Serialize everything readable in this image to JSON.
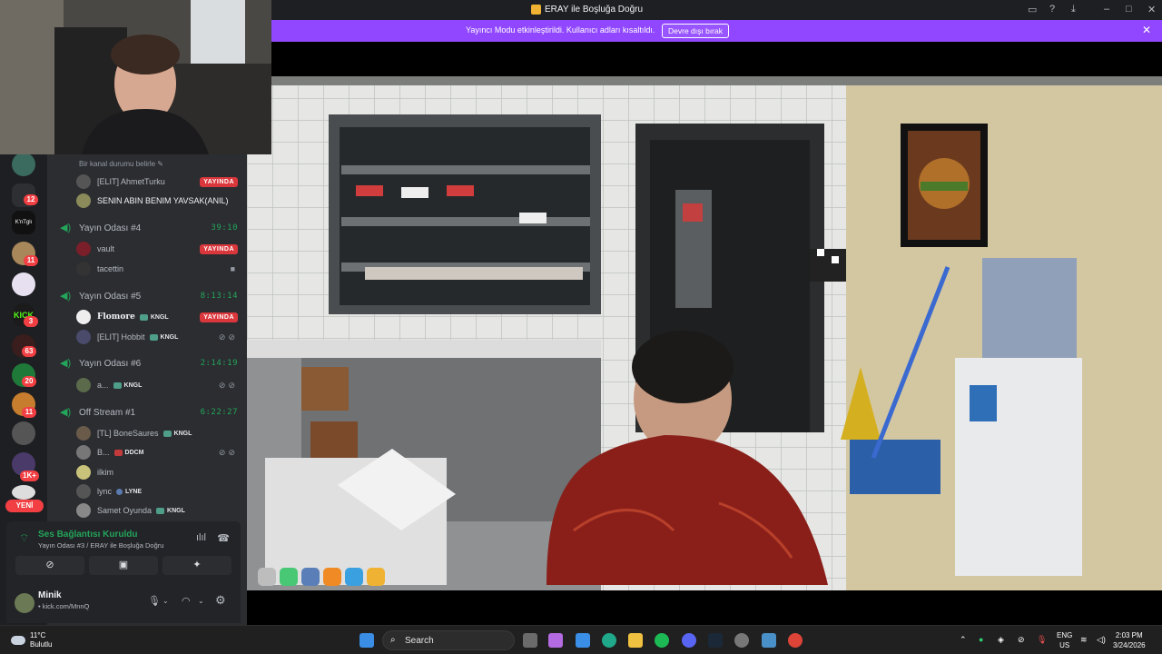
{
  "window": {
    "title": "ERAY ile Boşluğa Doğru"
  },
  "banner": {
    "text": "Yayıncı Modu etkinleştirildi. Kullanıcı adları kısaltıldı.",
    "button_label": "Devre dışı bırak"
  },
  "rail": {
    "badges": [
      "12",
      "11",
      "3",
      "63",
      "20",
      "11",
      "1K+"
    ],
    "server_label_text": "K'nTglı",
    "new_label": "YENİ"
  },
  "channels": {
    "status_line": "Bir kanal durumu belirle",
    "users_top": [
      {
        "name": "[ELIT] AhmetTurku",
        "live": "YAYINDA"
      },
      {
        "name": "SENIN ABIN BENIM YAVSAK(ANIL)"
      }
    ],
    "rooms": [
      {
        "name": "Yayın Odası #4",
        "time": "39:10",
        "users": [
          {
            "name": "vault",
            "live": "YAYINDA"
          },
          {
            "name": "tacettin"
          }
        ]
      },
      {
        "name": "Yayın Odası #5",
        "time": "8:13:14",
        "users": [
          {
            "name": "Flomore",
            "tag": "KNGL",
            "live": "YAYINDA"
          },
          {
            "name": "[ELIT] Hobbit",
            "tag": "KNGL"
          }
        ]
      },
      {
        "name": "Yayın Odası #6",
        "time": "2:14:19",
        "users": [
          {
            "name": "a...",
            "tag": "KNGL"
          }
        ]
      },
      {
        "name": "Off Stream #1",
        "time": "6:22:27",
        "users": [
          {
            "name": "[TL] BoneSaures",
            "tag": "KNGL"
          },
          {
            "name": "B...",
            "tag": "DDCM"
          },
          {
            "name": "ilkim"
          },
          {
            "name": "lync",
            "tag": "LYNE"
          },
          {
            "name": "Samet Oyunda",
            "tag": "KNGL"
          }
        ]
      }
    ]
  },
  "voice": {
    "title": "Ses Bağlantısı Kuruldu",
    "subtitle": "Yayın Odası #3 / ERAY ile Boşluğa Doğru"
  },
  "user": {
    "name": "Minik",
    "status": "• kick.com/MnnQ"
  },
  "taskbar": {
    "weather_temp": "11°C",
    "weather_desc": "Bulutlu",
    "search_placeholder": "Search",
    "lang_top": "ENG",
    "lang_bottom": "US",
    "time": "2:03 PM",
    "date": "3/24/2026"
  },
  "colors": {
    "accent": "#9147ff",
    "live": "#da373c",
    "voice_green": "#23a55a"
  }
}
